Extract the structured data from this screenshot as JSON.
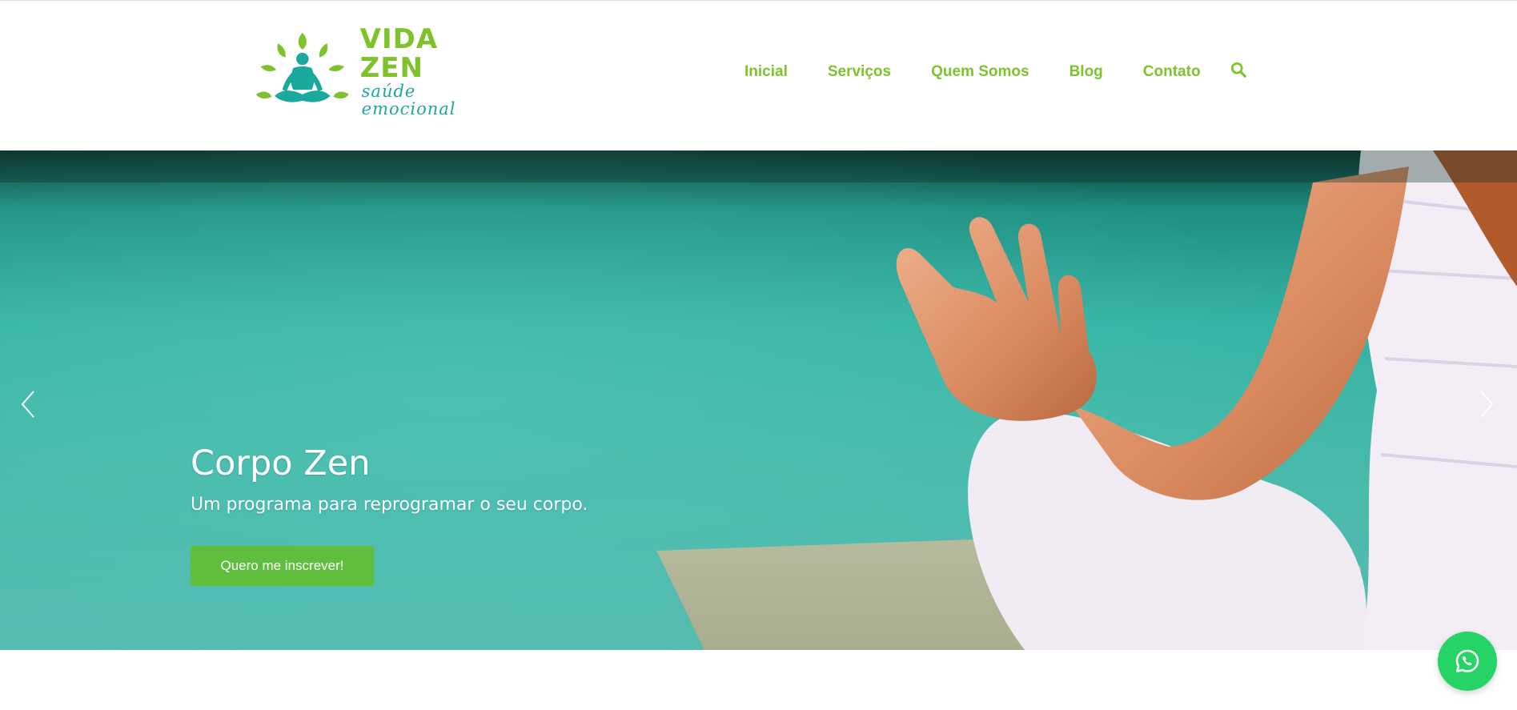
{
  "brand": {
    "name": "VIDA ZEN",
    "tagline": "saúde emocional",
    "colors": {
      "green": "#7ec22c",
      "teal": "#1aa99c"
    }
  },
  "nav": {
    "items": [
      "Inicial",
      "Serviços",
      "Quem Somos",
      "Blog",
      "Contato"
    ],
    "search_icon": "search-icon"
  },
  "hero": {
    "title": "Corpo Zen",
    "subtitle": "Um programa para reprogramar o seu corpo.",
    "button_label": "Quero me inscrever!",
    "button_color": "#5fbe3e",
    "prev_icon": "chevron-left-icon",
    "next_icon": "chevron-right-icon"
  },
  "whatsapp": {
    "icon": "whatsapp-icon",
    "color": "#25d366"
  }
}
